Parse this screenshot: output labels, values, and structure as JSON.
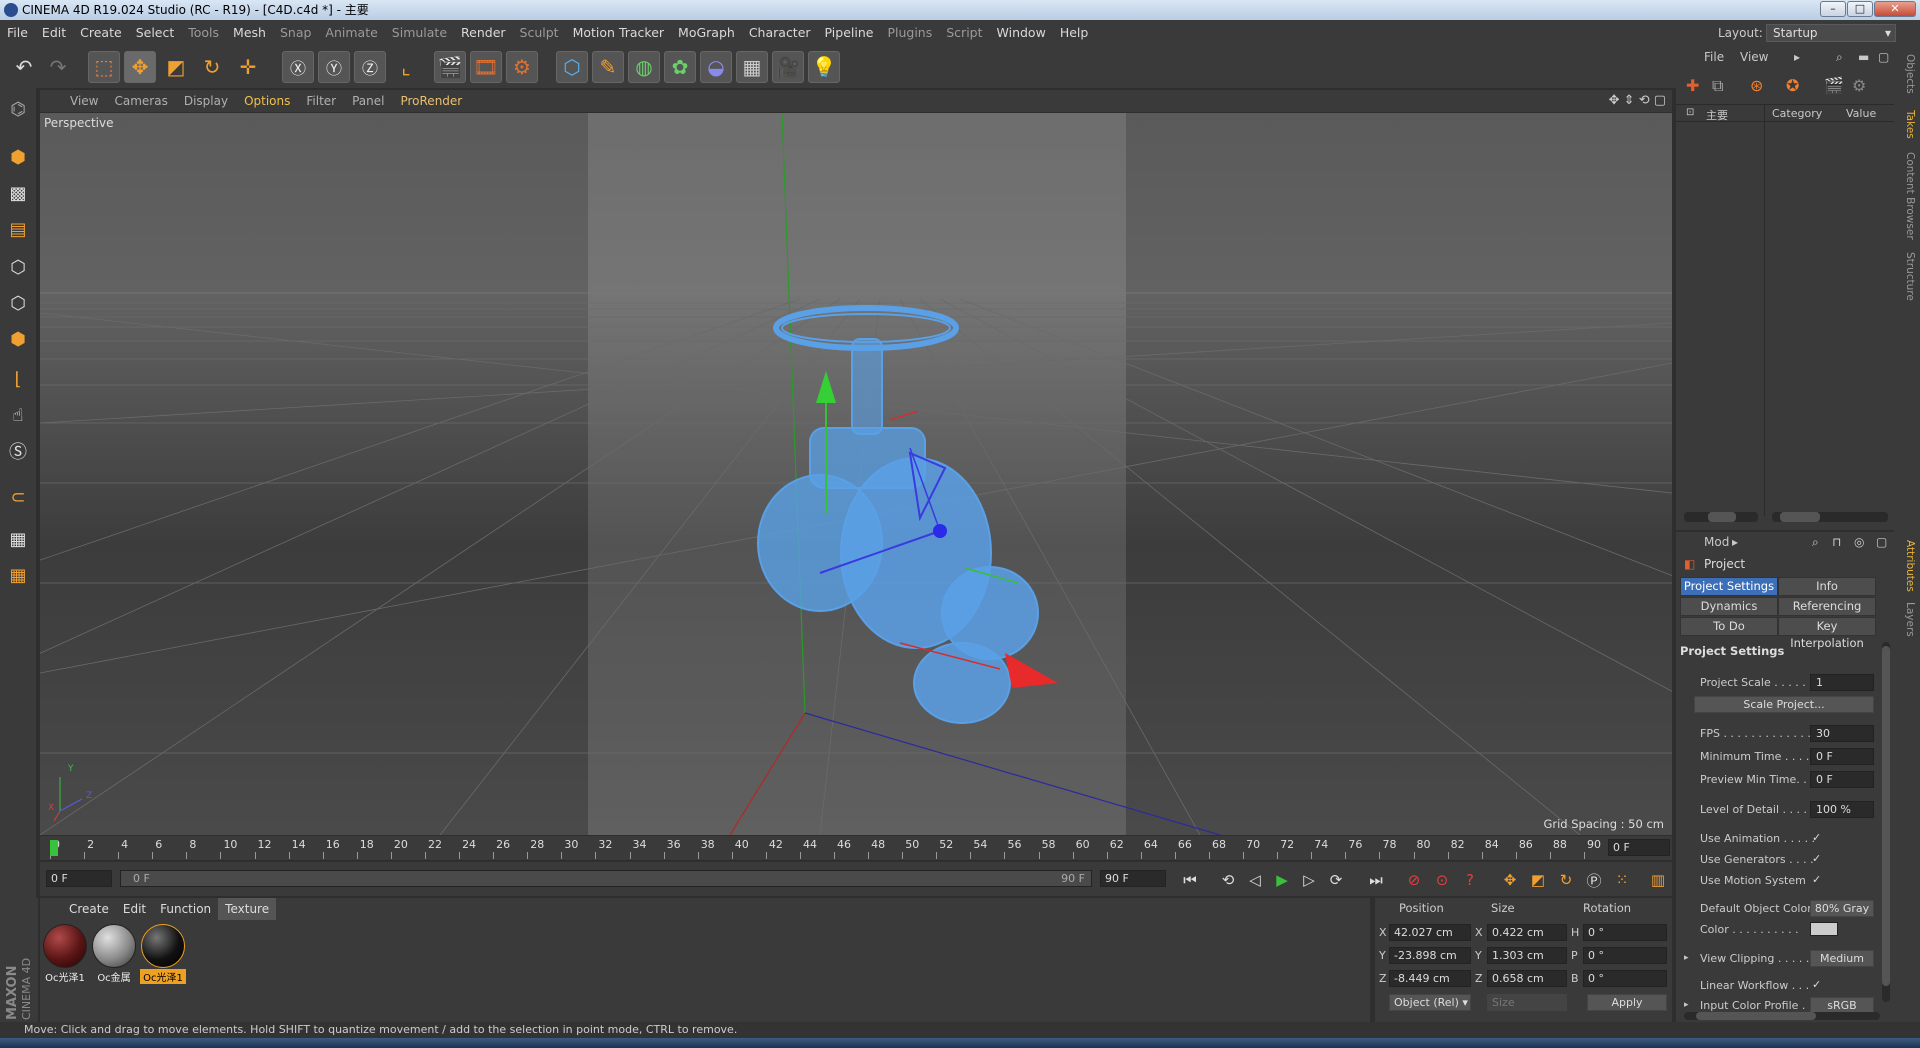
{
  "window": {
    "title": "CINEMA 4D R19.024 Studio (RC - R19) - [C4D.c4d *] - 主要",
    "layout_label": "Layout:",
    "layout_value": "Startup"
  },
  "menu": [
    "File",
    "Edit",
    "Create",
    "Select",
    "Tools",
    "Mesh",
    "Snap",
    "Animate",
    "Simulate",
    "Render",
    "Sculpt",
    "Motion Tracker",
    "MoGraph",
    "Character",
    "Pipeline",
    "Plugins",
    "Script",
    "Window",
    "Help"
  ],
  "viewport": {
    "menu": [
      "View",
      "Cameras",
      "Display",
      "Options",
      "Filter",
      "Panel",
      "ProRender"
    ],
    "active_menu": "Options",
    "camera_label": "Perspective",
    "grid_spacing": "Grid Spacing : 50 cm",
    "axis_x": "X",
    "axis_y": "Y",
    "axis_z": "Z"
  },
  "timeline": {
    "ticks": [
      "0",
      "2",
      "4",
      "6",
      "8",
      "10",
      "12",
      "14",
      "16",
      "18",
      "20",
      "22",
      "24",
      "26",
      "28",
      "30",
      "32",
      "34",
      "36",
      "38",
      "40",
      "42",
      "44",
      "46",
      "48",
      "50",
      "52",
      "54",
      "56",
      "58",
      "60",
      "62",
      "64",
      "66",
      "68",
      "70",
      "72",
      "74",
      "76",
      "78",
      "80",
      "82",
      "84",
      "86",
      "88",
      "90"
    ],
    "current_frame": "0 F",
    "start_frame": "0 F",
    "range_start": "0 F",
    "range_end": "90 F",
    "end_frame": "90 F",
    "current_progress": 0
  },
  "materials": {
    "menu": [
      "Create",
      "Edit",
      "Function",
      "Texture"
    ],
    "active_menu": "Texture",
    "items": [
      {
        "label": "Oc光泽1",
        "color": "#5a1414"
      },
      {
        "label": "Oc金属",
        "color": "#8a8a8a"
      },
      {
        "label": "Oc光泽1",
        "color": "#111111",
        "selected": true
      }
    ]
  },
  "coordinates": {
    "headers": [
      "Position",
      "Size",
      "Rotation"
    ],
    "rows": [
      {
        "axis": "X",
        "pos": "42.027 cm",
        "size_axis": "X",
        "size": "0.422 cm",
        "rot_axis": "H",
        "rot": "0 °"
      },
      {
        "axis": "Y",
        "pos": "-23.898 cm",
        "size_axis": "Y",
        "size": "1.303 cm",
        "rot_axis": "P",
        "rot": "0 °"
      },
      {
        "axis": "Z",
        "pos": "-8.449 cm",
        "size_axis": "Z",
        "size": "0.658 cm",
        "rot_axis": "B",
        "rot": "0 °"
      }
    ],
    "mode": "Object (Rel)",
    "size_mode": "Size",
    "apply": "Apply"
  },
  "status": "Move: Click and drag to move elements. Hold SHIFT to quantize movement / add to the selection in point mode, CTRL to remove.",
  "object_manager": {
    "menu": [
      "File",
      "View"
    ],
    "take": "主要",
    "columns": [
      "Category",
      "Value"
    ]
  },
  "attributes": {
    "mode": "Mod",
    "object": "Project",
    "tabs": [
      "Project Settings",
      "Info",
      "Dynamics",
      "Referencing",
      "To Do",
      "Key Interpolation"
    ],
    "active_tab": "Project Settings",
    "section": "Project Settings",
    "project_scale_label": "Project Scale . . . . . .",
    "project_scale": "1",
    "scale_project": "Scale Project...",
    "fps_label": "FPS . . . . . . . . . . . . .",
    "fps": "30",
    "min_time_label": "Minimum Time . . . .",
    "min_time": "0 F",
    "preview_min_label": "Preview Min Time. . .",
    "preview_min": "0 F",
    "lod_label": "Level of Detail . . . . .",
    "lod": "100 %",
    "use_animation": "Use Animation . . . . .",
    "use_generators": "Use Generators . . . .",
    "use_motion": "Use Motion System",
    "default_color_label": "Default Object Color",
    "default_color": "80% Gray",
    "color_label": "Color . . . . . . . . . .",
    "view_clipping_label": "View Clipping . . . . .",
    "view_clipping": "Medium",
    "linear_workflow": "Linear Workflow . . .",
    "input_profile_label": "Input Color Profile . .",
    "input_profile": "sRGB",
    "check": "✓"
  },
  "side_tabs": [
    "Objects",
    "Takes",
    "Content Browser",
    "Structure",
    "Attributes",
    "Layers"
  ],
  "colors": {
    "accent": "#e8a020",
    "selection_blue": "#3d6fb8",
    "mesh_blue": "#5aa0e6"
  }
}
